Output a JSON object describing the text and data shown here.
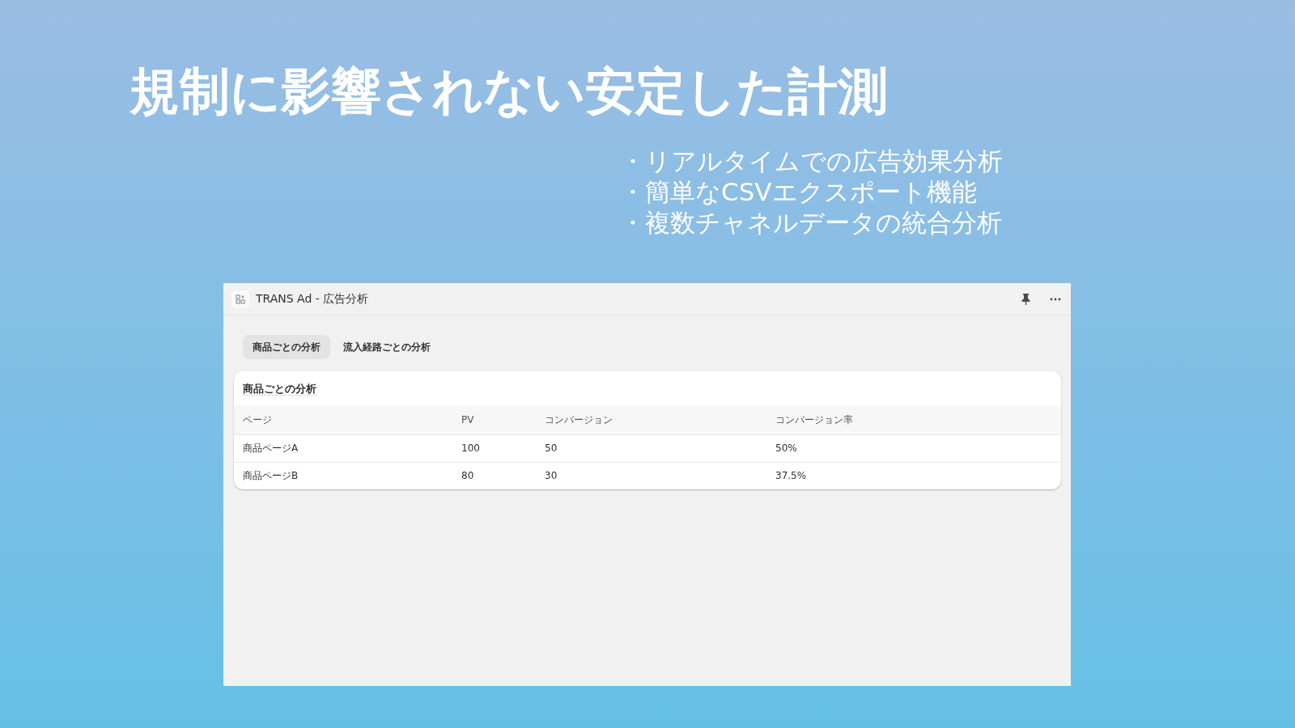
{
  "headline": "規制に影響されない安定した計測",
  "bullets": [
    "・リアルタイムでの広告効果分析",
    "・簡単なCSVエクスポート機能",
    "・複数チャネルデータの統合分析"
  ],
  "window": {
    "title": "TRANS Ad - 広告分析"
  },
  "tabs": [
    {
      "label": "商品ごとの分析",
      "selected": true
    },
    {
      "label": "流入経路ごとの分析",
      "selected": false
    }
  ],
  "table": {
    "title": "商品ごとの分析",
    "columns": [
      "ページ",
      "PV",
      "コンバージョン",
      "コンバージョン率"
    ],
    "rows": [
      [
        "商品ページA",
        "100",
        "50",
        "50%"
      ],
      [
        "商品ページB",
        "80",
        "30",
        "37.5%"
      ]
    ]
  }
}
